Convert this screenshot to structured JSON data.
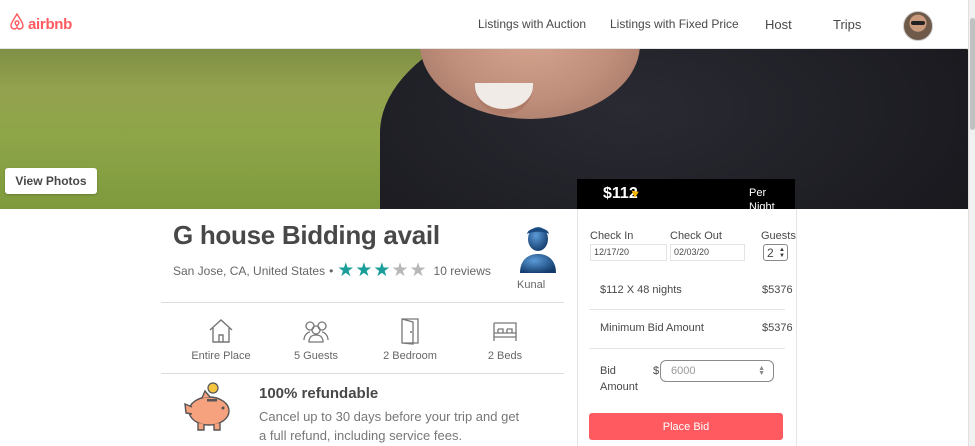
{
  "header": {
    "brand": "airbnb",
    "nav": [
      "Listings with Auction",
      "Listings with Fixed Price",
      "Host",
      "Trips"
    ]
  },
  "hero": {
    "view_photos_label": "View Photos"
  },
  "price": {
    "amount": "$112",
    "per_label": "Per Night"
  },
  "listing": {
    "title": "G house Bidding avail",
    "location": "San Jose, CA, United States",
    "rating": 3,
    "rating_max": 5,
    "reviews": "10 reviews",
    "host_name": "Kunal",
    "amenities": [
      {
        "icon": "house-icon",
        "label": "Entire Place"
      },
      {
        "icon": "guests-icon",
        "label": "5 Guests"
      },
      {
        "icon": "door-icon",
        "label": "2 Bedroom"
      },
      {
        "icon": "bed-icon",
        "label": "2 Beds"
      }
    ],
    "refund_title": "100% refundable",
    "refund_desc": "Cancel up to 30 days before your trip and get a full refund, including service fees."
  },
  "booking": {
    "check_in_label": "Check In",
    "check_in_value": "12/17/20",
    "check_out_label": "Check Out",
    "check_out_value": "02/03/20",
    "guests_label": "Guests",
    "guests_value": "2",
    "nights_text": "$112 X 48 nights",
    "nights_total": "$5376",
    "min_bid_label": "Minimum Bid Amount",
    "min_bid_value": "$5376",
    "bid_label_1": "Bid",
    "bid_label_2": "Amount",
    "bid_currency": "$",
    "bid_placeholder": "6000",
    "place_bid_label": "Place Bid"
  },
  "colors": {
    "brand": "#ff5a5f",
    "star": "#199e9a"
  }
}
